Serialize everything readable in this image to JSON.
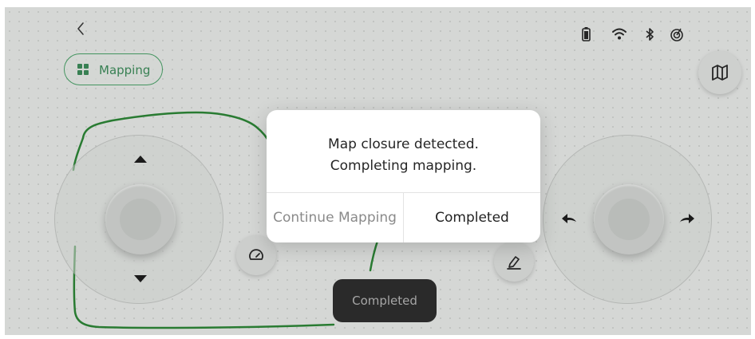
{
  "header": {
    "back_icon": "chevron-left-icon",
    "status_icons": [
      "battery-icon",
      "wifi-icon",
      "bluetooth-icon",
      "signal-icon"
    ]
  },
  "mode_badge": {
    "label": "Mapping",
    "icon": "grid-icon",
    "color": "#4ba56a"
  },
  "map_button": {
    "icon": "map-icon"
  },
  "left_joystick": {
    "up_icon": "triangle-up-icon",
    "down_icon": "triangle-down-icon"
  },
  "right_joystick": {
    "left_icon": "turn-left-arrow-icon",
    "right_icon": "turn-right-arrow-icon"
  },
  "speed_button": {
    "icon": "speedometer-icon"
  },
  "edit_button": {
    "icon": "pencil-icon"
  },
  "map_outline_color": "#2e8a38",
  "dialog": {
    "message_line1": "Map closure detected.",
    "message_line2": "Completing mapping.",
    "continue_label": "Continue Mapping",
    "completed_label": "Completed"
  },
  "toast": {
    "text": "Completed"
  }
}
